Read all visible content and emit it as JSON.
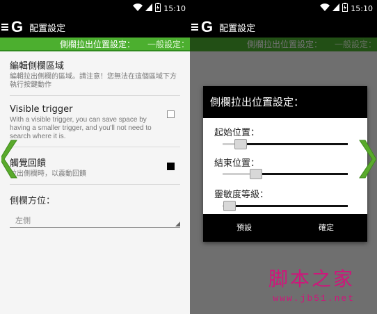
{
  "status": {
    "time": "15:10"
  },
  "app": {
    "title": "配置設定"
  },
  "tabs": {
    "section_a": "側欄拉出位置設定：",
    "section_b": "一般設定："
  },
  "settings": {
    "edit_area": {
      "title": "編輯側欄區域",
      "summary": "編輯拉出側欄的區域。請注意！您無法在這個區域下方執行按鍵動作"
    },
    "visible_trigger": {
      "title": "Visible trigger",
      "summary": "With a visible trigger, you can save space by having a smaller trigger, and you'll not need to search where it is.",
      "checked": false
    },
    "haptic": {
      "title": "觸覺回饋",
      "summary": "拉出側欄時，以震動回饋",
      "checked": true
    },
    "side_position": {
      "label": "側欄方位：",
      "value": "左側"
    }
  },
  "dialog": {
    "title": "側欄拉出位置設定：",
    "sliders": [
      {
        "label": "起始位置：",
        "value": 0.12
      },
      {
        "label": "結束位置：",
        "value": 0.25
      },
      {
        "label": "靈敏度等級：",
        "value": 0.02
      }
    ],
    "default_button": "預設",
    "ok_button": "確定"
  },
  "colors": {
    "accent_green": "#4caf2f",
    "arrow_green": "#5aaa2c"
  },
  "watermark": {
    "line1": "脚本之家",
    "line2": "www.jb51.net"
  }
}
